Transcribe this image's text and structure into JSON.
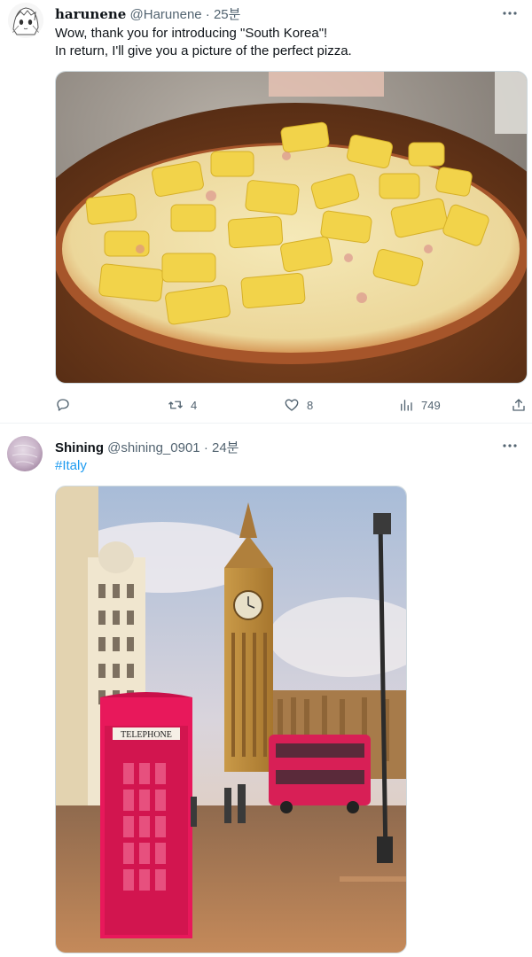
{
  "tweet1": {
    "display_name": "harunene",
    "handle": "@Harunene",
    "separator": "·",
    "time": "25분",
    "text_line1": "Wow, thank you for introducing \"South Korea\"!",
    "text_line2": "In return, I'll give you a picture of the perfect pizza.",
    "actions": {
      "reply_icon": "reply-icon",
      "retweet_count": "4",
      "like_count": "8",
      "views_count": "749",
      "share_icon": "share-icon"
    }
  },
  "tweet2": {
    "display_name": "Shining",
    "handle": "@shining_0901",
    "separator": "·",
    "time": "24분",
    "hashtag": "#Italy",
    "photo_sign": "TELEPHONE"
  },
  "colors": {
    "text_primary": "#0f1419",
    "text_secondary": "#536471",
    "link": "#1d9bf0",
    "border": "#eff3f4"
  }
}
